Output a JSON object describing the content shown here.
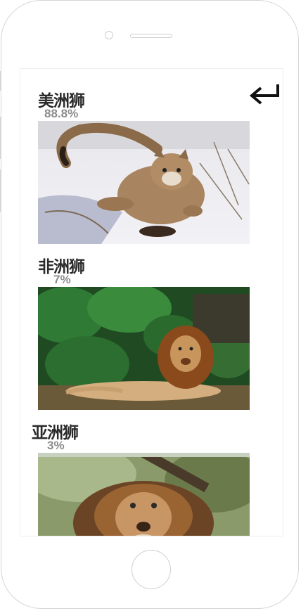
{
  "animals": [
    {
      "name": "美洲狮",
      "percent": "88.8%",
      "photo": "cougar-photo"
    },
    {
      "name": "非洲狮",
      "percent": "7%",
      "photo": "african-lion-photo"
    },
    {
      "name": "亚洲狮",
      "percent": "3%",
      "photo": "asiatic-lion-photo"
    }
  ],
  "icons": {
    "back": "return-arrow-icon"
  },
  "colors": {
    "title": "#2b2b2b",
    "percent": "#8c8c8c"
  }
}
